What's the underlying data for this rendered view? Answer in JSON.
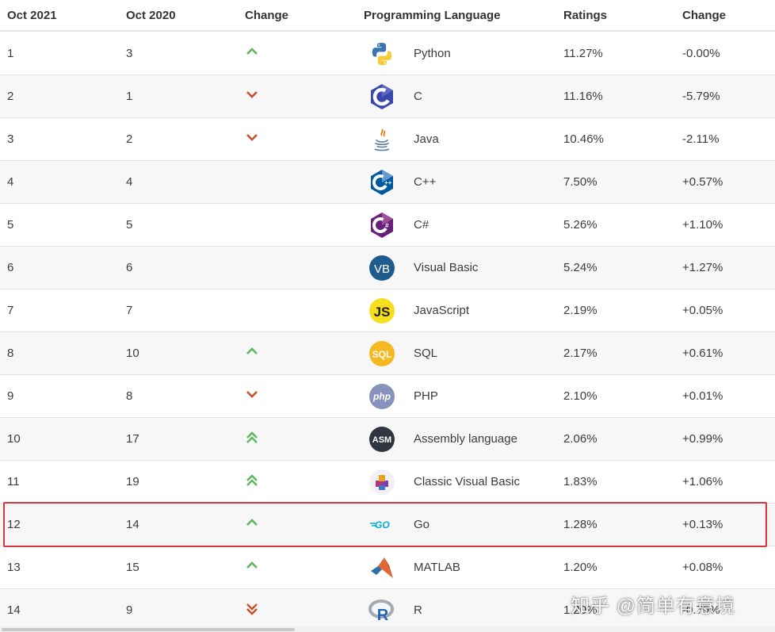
{
  "headers": {
    "current": "Oct 2021",
    "previous": "Oct 2020",
    "change": "Change",
    "language": "Programming Language",
    "ratings": "Ratings",
    "delta": "Change"
  },
  "colors": {
    "up": "#5cb85c",
    "down": "#c9502a",
    "highlight": "#d9353b"
  },
  "rows": [
    {
      "rank": "1",
      "prev": "3",
      "change": "up",
      "icon": "python-icon",
      "language": "Python",
      "rating": "11.27%",
      "delta": "-0.00%"
    },
    {
      "rank": "2",
      "prev": "1",
      "change": "down",
      "icon": "c-icon",
      "language": "C",
      "rating": "11.16%",
      "delta": "-5.79%"
    },
    {
      "rank": "3",
      "prev": "2",
      "change": "down",
      "icon": "java-icon",
      "language": "Java",
      "rating": "10.46%",
      "delta": "-2.11%"
    },
    {
      "rank": "4",
      "prev": "4",
      "change": "none",
      "icon": "cpp-icon",
      "language": "C++",
      "rating": "7.50%",
      "delta": "+0.57%"
    },
    {
      "rank": "5",
      "prev": "5",
      "change": "none",
      "icon": "csharp-icon",
      "language": "C#",
      "rating": "5.26%",
      "delta": "+1.10%"
    },
    {
      "rank": "6",
      "prev": "6",
      "change": "none",
      "icon": "visual-basic-icon",
      "language": "Visual Basic",
      "rating": "5.24%",
      "delta": "+1.27%"
    },
    {
      "rank": "7",
      "prev": "7",
      "change": "none",
      "icon": "javascript-icon",
      "language": "JavaScript",
      "rating": "2.19%",
      "delta": "+0.05%"
    },
    {
      "rank": "8",
      "prev": "10",
      "change": "up",
      "icon": "sql-icon",
      "language": "SQL",
      "rating": "2.17%",
      "delta": "+0.61%"
    },
    {
      "rank": "9",
      "prev": "8",
      "change": "down",
      "icon": "php-icon",
      "language": "PHP",
      "rating": "2.10%",
      "delta": "+0.01%"
    },
    {
      "rank": "10",
      "prev": "17",
      "change": "up2",
      "icon": "assembly-icon",
      "language": "Assembly language",
      "rating": "2.06%",
      "delta": "+0.99%"
    },
    {
      "rank": "11",
      "prev": "19",
      "change": "up2",
      "icon": "classic-vb-icon",
      "language": "Classic Visual Basic",
      "rating": "1.83%",
      "delta": "+1.06%"
    },
    {
      "rank": "12",
      "prev": "14",
      "change": "up",
      "icon": "go-icon",
      "language": "Go",
      "rating": "1.28%",
      "delta": "+0.13%"
    },
    {
      "rank": "13",
      "prev": "15",
      "change": "up",
      "icon": "matlab-icon",
      "language": "MATLAB",
      "rating": "1.20%",
      "delta": "+0.08%"
    },
    {
      "rank": "14",
      "prev": "9",
      "change": "down2",
      "icon": "r-icon",
      "language": "R",
      "rating": "1.20%",
      "delta": "-0.79%"
    }
  ],
  "watermark": "知乎 @简单有意境"
}
